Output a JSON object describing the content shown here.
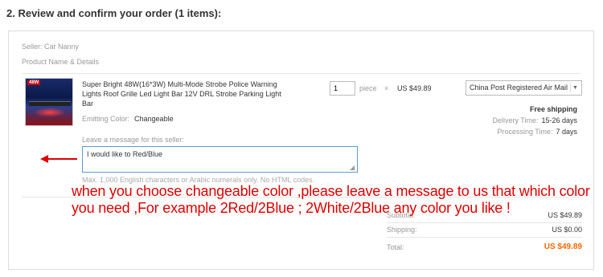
{
  "section": {
    "title": "2. Review and confirm your order (1 items):"
  },
  "order": {
    "seller_label": "Seller: Car Nanny",
    "product_header": "Product Name & Details",
    "product": {
      "name": "Super Bright 48W(16*3W) Multi-Mode Strobe Police Warning Lights Roof Grille Led Light Bar 12V DRL Strobe Parking Light Bar",
      "thumbnail_tag": "48W",
      "color_label": "Emitting Color:",
      "color_value": "Changeable"
    },
    "quantity": {
      "value": "1",
      "unit": "piece",
      "times": "×",
      "unit_price": "US $49.89"
    },
    "shipping": {
      "method": "China Post Registered Air Mail",
      "free_label": "Free shipping",
      "delivery_label": "Delivery Time:",
      "delivery_value": "15-26 days",
      "processing_label": "Processing Time:",
      "processing_value": "7 days"
    },
    "message": {
      "label": "Leave a message for this seller:",
      "value": "I would like to Red/Blue",
      "hint": "Max. 1,000 English characters or Arabic numerals only. No HTML codes."
    },
    "summary": {
      "subtotal_label": "Subtotal:",
      "subtotal_value": "US $49.89",
      "shipping_label": "Shipping:",
      "shipping_value": "US $0.00",
      "total_label": "Total:",
      "total_value": "US $49.89"
    }
  },
  "annotation": {
    "text": "when you choose changeable color ,please leave a message to us that which color you need ,For example 2Red/2Blue ; 2White/2Blue any color you like !",
    "color": "#e00000"
  },
  "colors": {
    "accent_total": "#ff6600",
    "textarea_border": "#5b9bd5"
  }
}
